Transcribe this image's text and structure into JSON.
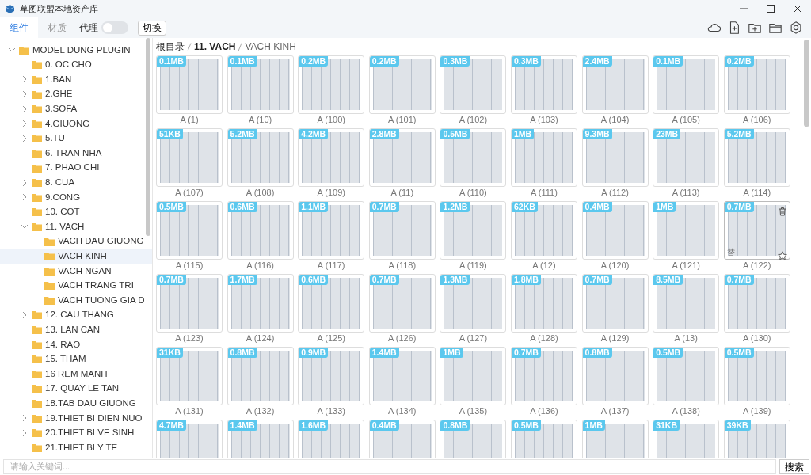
{
  "window": {
    "title": "草图联盟本地资产库"
  },
  "tabs": [
    {
      "label": "组件",
      "selected": true
    },
    {
      "label": "材质",
      "selected": false
    }
  ],
  "proxy": {
    "label": "代理",
    "on": false
  },
  "switch_button": "切换",
  "tree": [
    {
      "label": "MODEL DUNG PLUGIN",
      "expanded": true,
      "selected": false,
      "children": [
        {
          "label": "0. OC CHO",
          "selected": false
        },
        {
          "label": "1.BAN",
          "expanded": false,
          "selected": false
        },
        {
          "label": "2.GHE",
          "expanded": false,
          "selected": false
        },
        {
          "label": "3.SOFA",
          "expanded": false,
          "selected": false
        },
        {
          "label": "4.GIUONG",
          "expanded": false,
          "selected": false
        },
        {
          "label": "5.TU",
          "expanded": false,
          "selected": false
        },
        {
          "label": "6. TRAN NHA",
          "selected": false
        },
        {
          "label": "7. PHAO CHI",
          "selected": false
        },
        {
          "label": "8. CUA",
          "expanded": false,
          "selected": false
        },
        {
          "label": "9.CONG",
          "expanded": false,
          "selected": false
        },
        {
          "label": "10. COT",
          "selected": false
        },
        {
          "label": "11. VACH",
          "expanded": true,
          "selected": false,
          "children": [
            {
              "label": "VACH DAU GIUONG",
              "selected": false
            },
            {
              "label": "VACH KINH",
              "selected": true
            },
            {
              "label": "VACH NGAN",
              "selected": false
            },
            {
              "label": "VACH TRANG TRI",
              "selected": false
            },
            {
              "label": "VACH TUONG GIA D",
              "selected": false
            }
          ]
        },
        {
          "label": "12. CAU THANG",
          "expanded": false,
          "selected": false
        },
        {
          "label": "13. LAN CAN",
          "selected": false
        },
        {
          "label": "14. RAO",
          "selected": false
        },
        {
          "label": "15. THAM",
          "selected": false
        },
        {
          "label": "16 REM MANH",
          "selected": false
        },
        {
          "label": "17. QUAY LE TAN",
          "selected": false
        },
        {
          "label": "18.TAB DAU GIUONG",
          "selected": false
        },
        {
          "label": "19.THIET BI DIEN NUO",
          "expanded": false,
          "selected": false
        },
        {
          "label": "20.THIET BI VE SINH",
          "expanded": false,
          "selected": false
        },
        {
          "label": "21.THIET BI Y TE",
          "selected": false
        }
      ]
    }
  ],
  "breadcrumb": [
    "根目录",
    "11. VACH",
    "VACH KINH"
  ],
  "assets": [
    {
      "size": "0.1MB",
      "name": "A (1)",
      "hovered": false
    },
    {
      "size": "0.1MB",
      "name": "A (10)",
      "hovered": false
    },
    {
      "size": "0.2MB",
      "name": "A (100)",
      "hovered": false
    },
    {
      "size": "0.2MB",
      "name": "A (101)",
      "hovered": false
    },
    {
      "size": "0.3MB",
      "name": "A (102)",
      "hovered": false
    },
    {
      "size": "0.3MB",
      "name": "A (103)",
      "hovered": false
    },
    {
      "size": "2.4MB",
      "name": "A (104)",
      "hovered": false
    },
    {
      "size": "0.1MB",
      "name": "A (105)",
      "hovered": false
    },
    {
      "size": "0.2MB",
      "name": "A (106)",
      "hovered": false
    },
    {
      "size": "51KB",
      "name": "A (107)",
      "hovered": false
    },
    {
      "size": "5.2MB",
      "name": "A (108)",
      "hovered": false
    },
    {
      "size": "4.2MB",
      "name": "A (109)",
      "hovered": false
    },
    {
      "size": "2.8MB",
      "name": "A (11)",
      "hovered": false
    },
    {
      "size": "0.5MB",
      "name": "A (110)",
      "hovered": false
    },
    {
      "size": "1MB",
      "name": "A (111)",
      "hovered": false
    },
    {
      "size": "9.3MB",
      "name": "A (112)",
      "hovered": false
    },
    {
      "size": "23MB",
      "name": "A (113)",
      "hovered": false
    },
    {
      "size": "5.2MB",
      "name": "A (114)",
      "hovered": false
    },
    {
      "size": "0.5MB",
      "name": "A (115)",
      "hovered": false
    },
    {
      "size": "0.6MB",
      "name": "A (116)",
      "hovered": false
    },
    {
      "size": "1.1MB",
      "name": "A (117)",
      "hovered": false
    },
    {
      "size": "0.7MB",
      "name": "A (118)",
      "hovered": false
    },
    {
      "size": "1.2MB",
      "name": "A (119)",
      "hovered": false
    },
    {
      "size": "62KB",
      "name": "A (12)",
      "hovered": false
    },
    {
      "size": "0.4MB",
      "name": "A (120)",
      "hovered": false
    },
    {
      "size": "1MB",
      "name": "A (121)",
      "hovered": false
    },
    {
      "size": "0.7MB",
      "name": "A (122)",
      "hovered": true,
      "replace_label": "替"
    },
    {
      "size": "0.7MB",
      "name": "A (123)",
      "hovered": false
    },
    {
      "size": "1.7MB",
      "name": "A (124)",
      "hovered": false
    },
    {
      "size": "0.6MB",
      "name": "A (125)",
      "hovered": false
    },
    {
      "size": "0.7MB",
      "name": "A (126)",
      "hovered": false
    },
    {
      "size": "1.3MB",
      "name": "A (127)",
      "hovered": false
    },
    {
      "size": "1.8MB",
      "name": "A (128)",
      "hovered": false
    },
    {
      "size": "0.7MB",
      "name": "A (129)",
      "hovered": false
    },
    {
      "size": "8.5MB",
      "name": "A (13)",
      "hovered": false
    },
    {
      "size": "0.7MB",
      "name": "A (130)",
      "hovered": false
    },
    {
      "size": "31KB",
      "name": "A (131)",
      "hovered": false
    },
    {
      "size": "0.8MB",
      "name": "A (132)",
      "hovered": false
    },
    {
      "size": "0.9MB",
      "name": "A (133)",
      "hovered": false
    },
    {
      "size": "1.4MB",
      "name": "A (134)",
      "hovered": false
    },
    {
      "size": "1MB",
      "name": "A (135)",
      "hovered": false
    },
    {
      "size": "0.7MB",
      "name": "A (136)",
      "hovered": false
    },
    {
      "size": "0.8MB",
      "name": "A (137)",
      "hovered": false
    },
    {
      "size": "0.5MB",
      "name": "A (138)",
      "hovered": false
    },
    {
      "size": "0.5MB",
      "name": "A (139)",
      "hovered": false
    },
    {
      "size": "4.7MB",
      "hovered": false
    },
    {
      "size": "1.4MB",
      "hovered": false
    },
    {
      "size": "1.6MB",
      "hovered": false
    },
    {
      "size": "0.4MB",
      "hovered": false
    },
    {
      "size": "0.8MB",
      "hovered": false
    },
    {
      "size": "0.5MB",
      "hovered": false
    },
    {
      "size": "1MB",
      "hovered": false
    },
    {
      "size": "31KB",
      "hovered": false
    },
    {
      "size": "39KB",
      "hovered": false
    }
  ],
  "search": {
    "placeholder": "请输入关键词...",
    "button": "搜索"
  }
}
